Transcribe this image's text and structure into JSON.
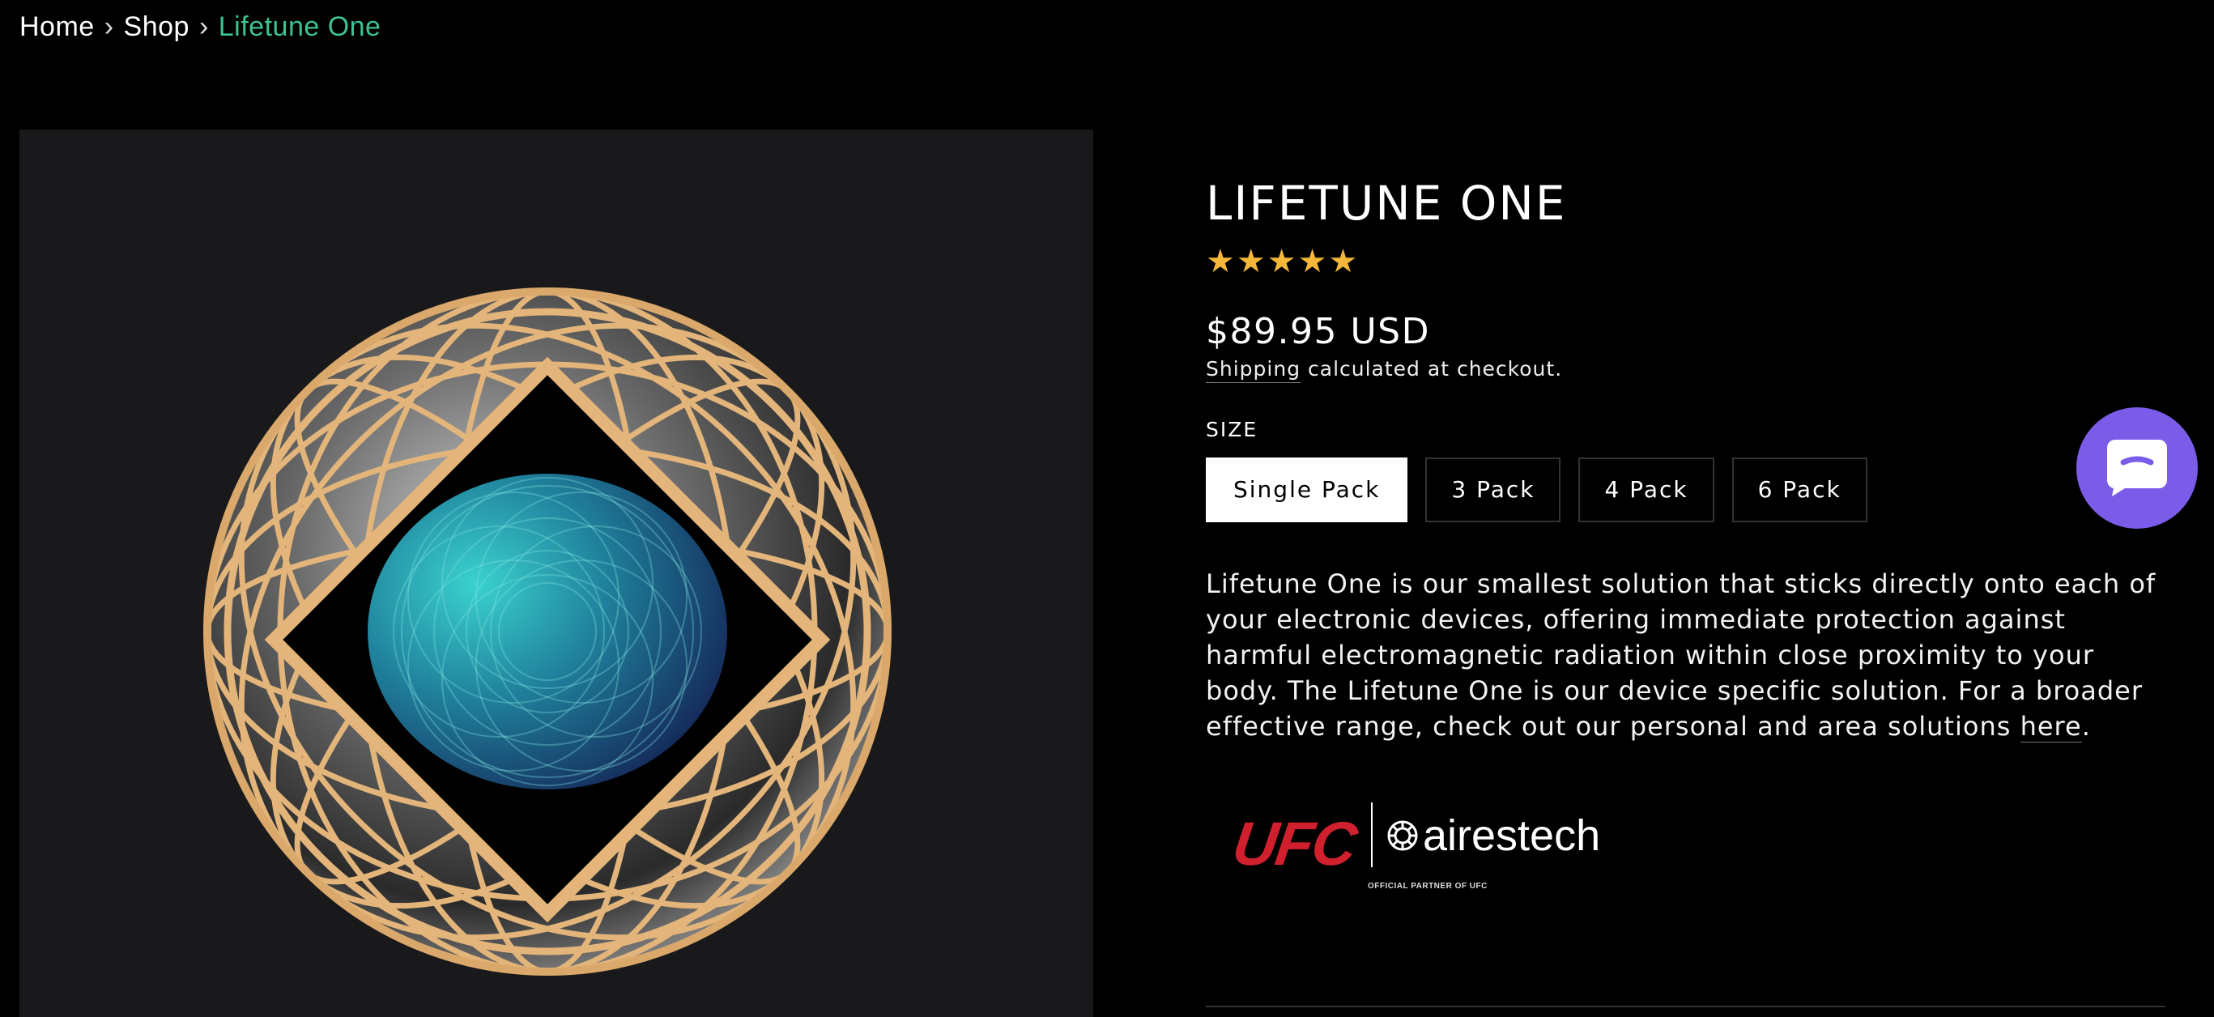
{
  "breadcrumb": {
    "home": "Home",
    "shop": "Shop",
    "current": "Lifetune One",
    "separator": "›"
  },
  "product": {
    "title": "LIFETUNE ONE",
    "rating": 5,
    "rating_max": 5,
    "stars": "★★★★★",
    "price": "$89.95 USD",
    "shipping_link": "Shipping",
    "shipping_rest": " calculated at checkout.",
    "size_label": "SIZE",
    "sizes": [
      "Single Pack",
      "3 Pack",
      "4 Pack",
      "6 Pack"
    ],
    "selected_size": "Single Pack",
    "description": " Lifetune One is our smallest solution that sticks directly onto each of your electronic devices, offering immediate protection against harmful electromagnetic radiation within close proximity to your body.  The Lifetune One is our device specific solution. For a broader effective range, check out our personal and area solutions ",
    "description_link": "here",
    "description_end": "."
  },
  "partner": {
    "ufc": "UFC",
    "brand": "airestech",
    "tagline": "OFFICIAL PARTNER OF UFC"
  },
  "colors": {
    "accent_green": "#3ec28f",
    "star_gold": "#f4b73a",
    "chat_purple": "#7b5ce8",
    "ufc_red": "#d0202e"
  },
  "icons": {
    "chat": "chat-bubble-icon",
    "partner": "airestech-logo-icon"
  }
}
